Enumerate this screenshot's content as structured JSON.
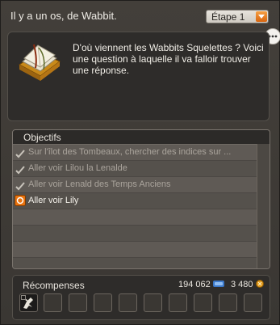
{
  "window": {
    "title": "Il y a un os, de Wabbit."
  },
  "step_select": {
    "value": "Étape 1"
  },
  "description": {
    "text": "D'où viennent les Wabbits Squelettes ? Voici une question à laquelle il va falloir trouver une réponse."
  },
  "objectives": {
    "header": "Objectifs",
    "items": [
      {
        "label": "Sur l'îlot des Tombeaux, chercher des indices sur ...",
        "done": true
      },
      {
        "label": "Aller voir Lilou la Lenalde",
        "done": true
      },
      {
        "label": "Aller voir Lenald des Temps Anciens",
        "done": true
      },
      {
        "label": "Aller voir Lily",
        "done": false
      }
    ]
  },
  "rewards": {
    "header": "Récompenses",
    "xp": "194 062",
    "kamas": "3 480"
  },
  "colors": {
    "accent": "#e8730f",
    "panel_dark": "#2e2c2a",
    "row_light": "#5f5a55"
  }
}
